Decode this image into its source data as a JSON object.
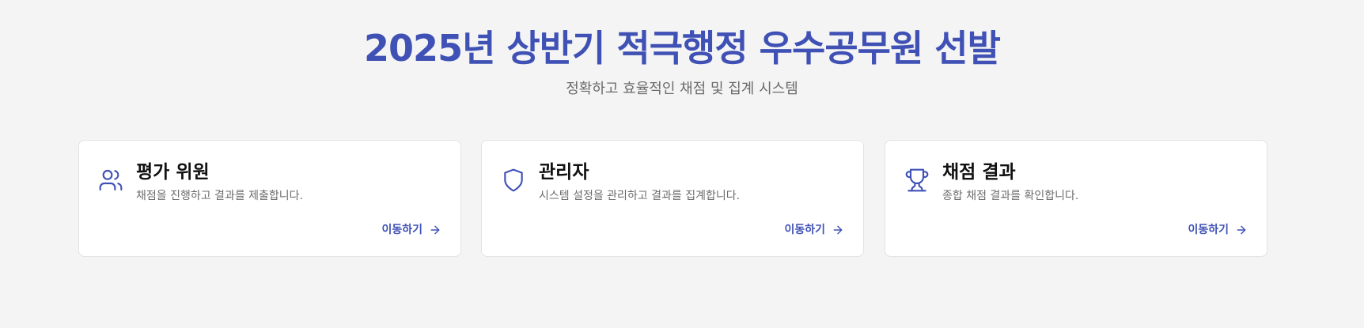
{
  "header": {
    "title": "2025년 상반기 적극행정 우수공무원 선발",
    "subtitle": "정확하고 효율적인 채점 및 집계 시스템"
  },
  "cards": [
    {
      "icon": "users-icon",
      "title": "평가 위원",
      "description": "채점을 진행하고 결과를 제출합니다.",
      "link_label": "이동하기"
    },
    {
      "icon": "shield-icon",
      "title": "관리자",
      "description": "시스템 설정을 관리하고 결과를 집계합니다.",
      "link_label": "이동하기"
    },
    {
      "icon": "trophy-icon",
      "title": "채점 결과",
      "description": "종합 채점 결과를 확인합니다.",
      "link_label": "이동하기"
    }
  ],
  "colors": {
    "accent": "#3f51b5",
    "background": "#f4f4f4",
    "card_background": "#ffffff",
    "muted_text": "#6b6b6b"
  }
}
